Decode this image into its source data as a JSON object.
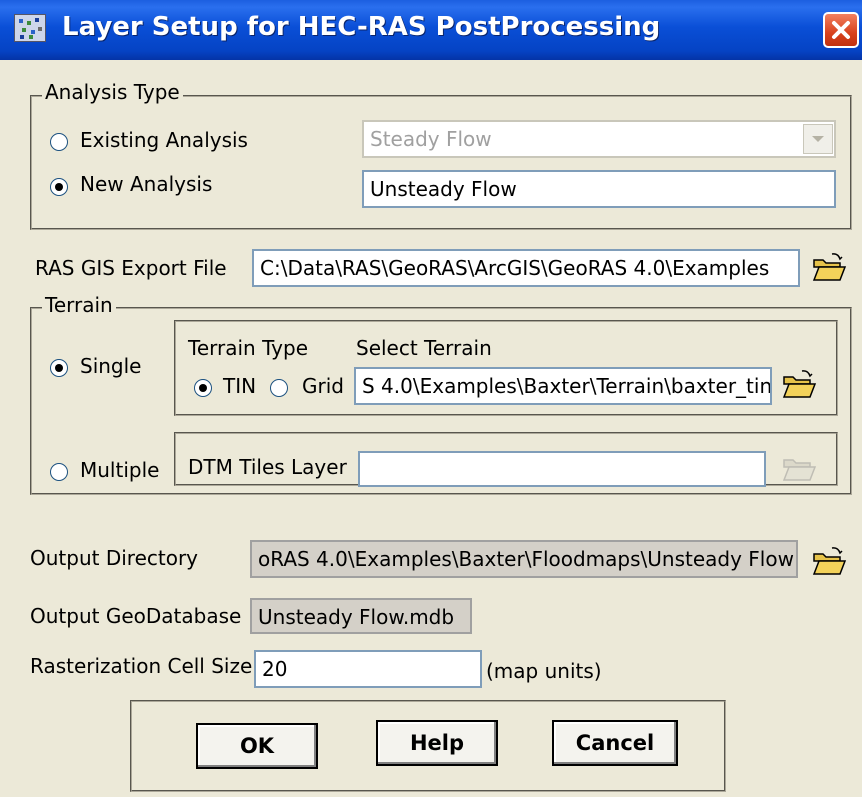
{
  "window": {
    "title": "Layer Setup for HEC-RAS PostProcessing",
    "icon": "hec-geoRAS-app-icon",
    "close_icon": "close-x-icon"
  },
  "analysis_type": {
    "group_label": "Analysis Type",
    "existing_label": "Existing Analysis",
    "existing_selected": false,
    "existing_value": "Steady Flow",
    "new_label": "New Analysis",
    "new_selected": true,
    "new_value": "Unsteady Flow"
  },
  "export_file": {
    "label": "RAS GIS Export File",
    "value": "C:\\Data\\RAS\\GeoRAS\\ArcGIS\\GeoRAS 4.0\\Examples"
  },
  "terrain": {
    "group_label": "Terrain",
    "single_label": "Single",
    "single_selected": true,
    "terrain_type_label": "Terrain Type",
    "select_terrain_label": "Select Terrain",
    "tin_label": "TIN",
    "tin_selected": true,
    "grid_label": "Grid",
    "grid_selected": false,
    "terrain_value": "S 4.0\\Examples\\Baxter\\Terrain\\baxter_tin",
    "multiple_label": "Multiple",
    "multiple_selected": false,
    "dtm_tiles_label": "DTM Tiles Layer",
    "dtm_tiles_value": ""
  },
  "output": {
    "directory_label": "Output Directory",
    "directory_value": "oRAS 4.0\\Examples\\Baxter\\Floodmaps\\Unsteady Flow",
    "geodatabase_label": "Output GeoDatabase",
    "geodatabase_value": "Unsteady Flow.mdb",
    "cell_size_label": "Rasterization Cell Size",
    "cell_size_value": "20",
    "cell_size_units": "(map units)"
  },
  "buttons": {
    "ok": "OK",
    "help": "Help",
    "cancel": "Cancel"
  },
  "colors": {
    "titlebar": "#0a4fd7",
    "dialog_bg": "#ece9d8",
    "close_button": "#d8421d"
  }
}
